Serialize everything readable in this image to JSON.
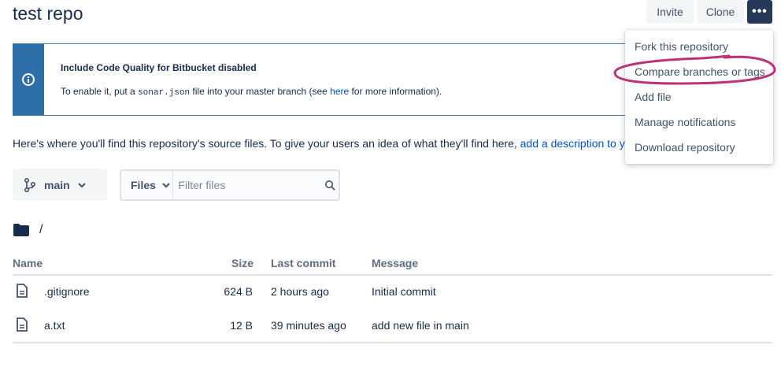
{
  "header": {
    "title": "test repo",
    "invite_label": "Invite",
    "clone_label": "Clone",
    "more_label": "•••"
  },
  "banner": {
    "title": "Include Code Quality for Bitbucket disabled",
    "text_prefix": "To enable it, put a ",
    "filename": "sonar.json",
    "text_middle": " file into your master branch (see ",
    "link": "here",
    "text_suffix": " for more information)."
  },
  "description": {
    "text": "Here's where you'll find this repository's source files. To give your users an idea of what they'll find here, ",
    "link": "add a description to y"
  },
  "branch": {
    "name": "main"
  },
  "filter": {
    "type_label": "Files",
    "placeholder": "Filter files"
  },
  "path": {
    "label": "/"
  },
  "table": {
    "headers": {
      "name": "Name",
      "size": "Size",
      "last_commit": "Last commit",
      "message": "Message"
    },
    "rows": [
      {
        "name": ".gitignore",
        "size": "624 B",
        "last_commit": "2 hours ago",
        "message": "Initial commit"
      },
      {
        "name": "a.txt",
        "size": "12 B",
        "last_commit": "39 minutes ago",
        "message": "add new file in main"
      }
    ]
  },
  "menu": {
    "items": [
      "Fork this repository",
      "Compare branches or tags",
      "Add file",
      "Manage notifications",
      "Download repository"
    ]
  },
  "colors": {
    "annotation": "#c0307a",
    "banner_accent": "#2d6ea8",
    "primary_dark": "#253858",
    "link": "#0052cc"
  }
}
